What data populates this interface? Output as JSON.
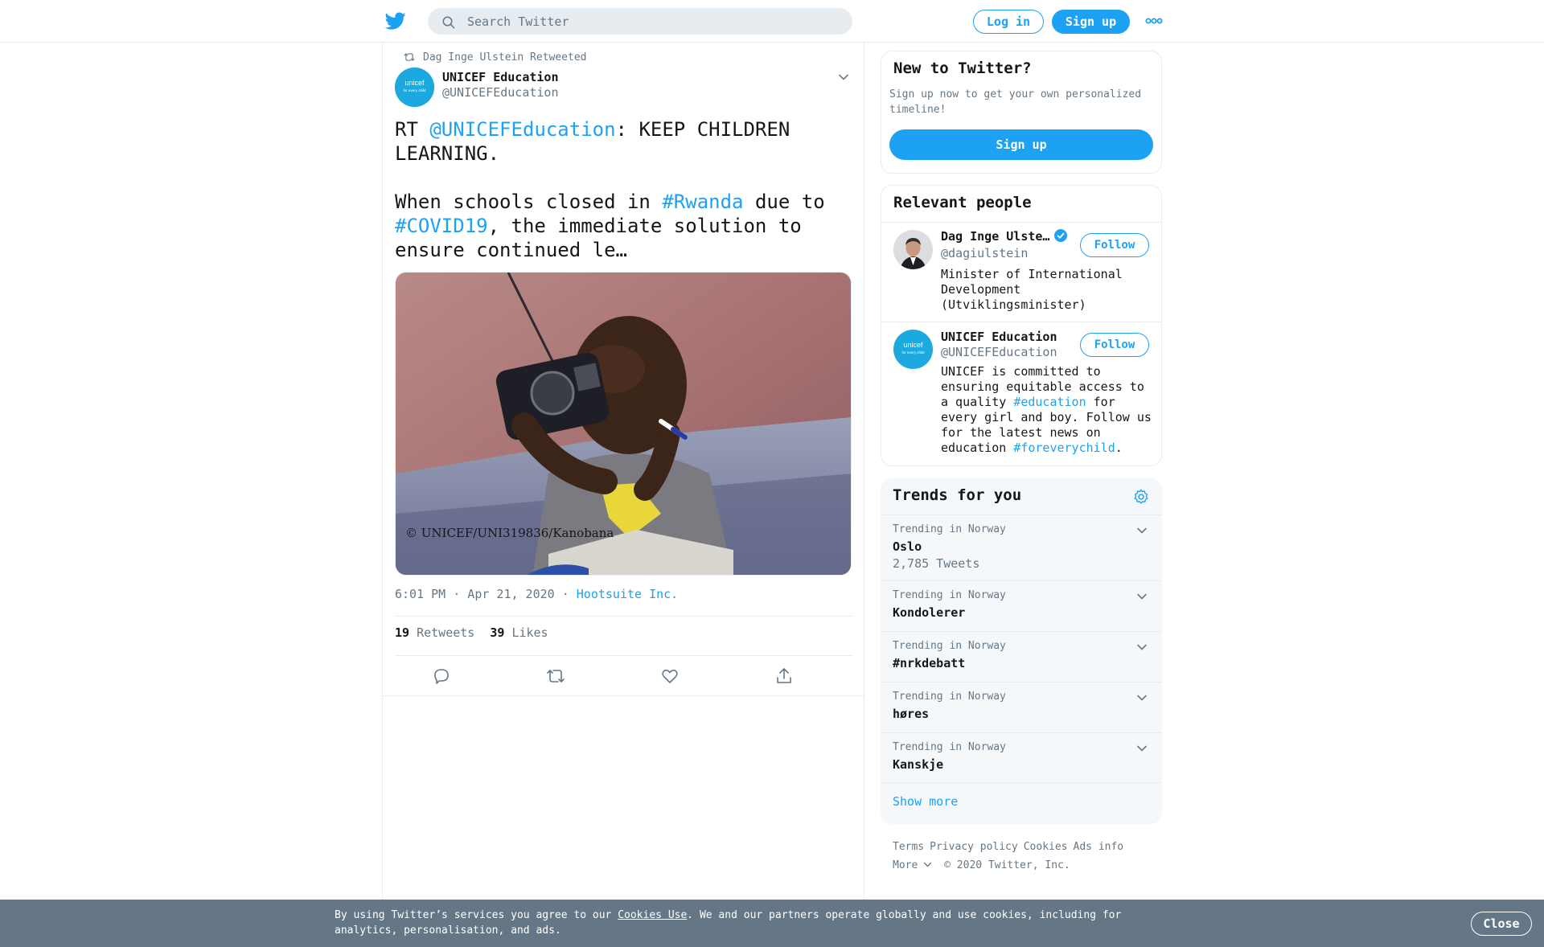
{
  "header": {
    "logo_icon": "twitter-bird-icon",
    "search_placeholder": "Search Twitter",
    "login_label": "Log in",
    "signup_label": "Sign up",
    "more_icon": "more-dots-icon"
  },
  "tweet": {
    "retweet_context": "Dag Inge Ulstein Retweeted",
    "author_name": "UNICEF Education",
    "author_handle": "@UNICEFEducation",
    "avatar_text_1": "unicef",
    "avatar_text_2": "for every child",
    "text_part1": "RT ",
    "mention": "@UNICEFEducation",
    "text_part2": ": KEEP CHILDREN LEARNING.\n\nWhen schools closed in ",
    "hashtag1": "#Rwanda",
    "text_part3": " due to\n",
    "hashtag2": "#COVID19",
    "text_part4": ", the immediate solution to ensure continued le…",
    "photo_caption": "© UNICEF/UNI319836/Kanobana",
    "timestamp": "6:01 PM · Apr 21, 2020",
    "meta_sep": " · ",
    "source": "Hootsuite Inc.",
    "retweets_count": "19",
    "retweets_label": "Retweets",
    "likes_count": "39",
    "likes_label": "Likes"
  },
  "new_to_twitter": {
    "title": "New to Twitter?",
    "subtitle": "Sign up now to get your own personalized timeline!",
    "signup_label": "Sign up"
  },
  "relevant_people": {
    "title": "Relevant people",
    "people": [
      {
        "name": "Dag Inge Ulste…",
        "handle": "@dagiulstein",
        "bio": "Minister of International Development (Utviklingsminister)",
        "follow_label": "Follow"
      },
      {
        "name": "UNICEF Education",
        "handle": "@UNICEFEducation",
        "bio_part1": "UNICEF is committed to ensuring equitable access to a quality ",
        "bio_tag1": "#education",
        "bio_part2": " for every girl and boy. Follow us for the latest news on education ",
        "bio_tag2": "#foreverychild",
        "bio_part3": ".",
        "follow_label": "Follow"
      }
    ]
  },
  "trends": {
    "title": "Trends for you",
    "items": [
      {
        "context": "Trending in Norway",
        "name": "Oslo",
        "count": "2,785 Tweets"
      },
      {
        "context": "Trending in Norway",
        "name": "Kondolerer"
      },
      {
        "context": "Trending in Norway",
        "name": "#nrkdebatt"
      },
      {
        "context": "Trending in Norway",
        "name": "høres"
      },
      {
        "context": "Trending in Norway",
        "name": "Kanskje"
      }
    ],
    "show_more": "Show more"
  },
  "footer": {
    "links": [
      "Terms",
      "Privacy policy",
      "Cookies",
      "Ads info"
    ],
    "more_label": "More",
    "copyright": "© 2020 Twitter, Inc."
  },
  "cookie_bar": {
    "text_part1": "By using Twitter’s services you agree to our ",
    "link": "Cookies Use",
    "text_part2": ". We and our partners operate globally and use cookies, including for analytics, personalisation, and ads.",
    "close_label": "Close"
  },
  "colors": {
    "accent": "#1da1f2",
    "text": "#14171a",
    "secondary": "#657786",
    "border": "#e6ecf0",
    "panel": "#f5f8fa",
    "unicef": "#1ca9e0"
  }
}
